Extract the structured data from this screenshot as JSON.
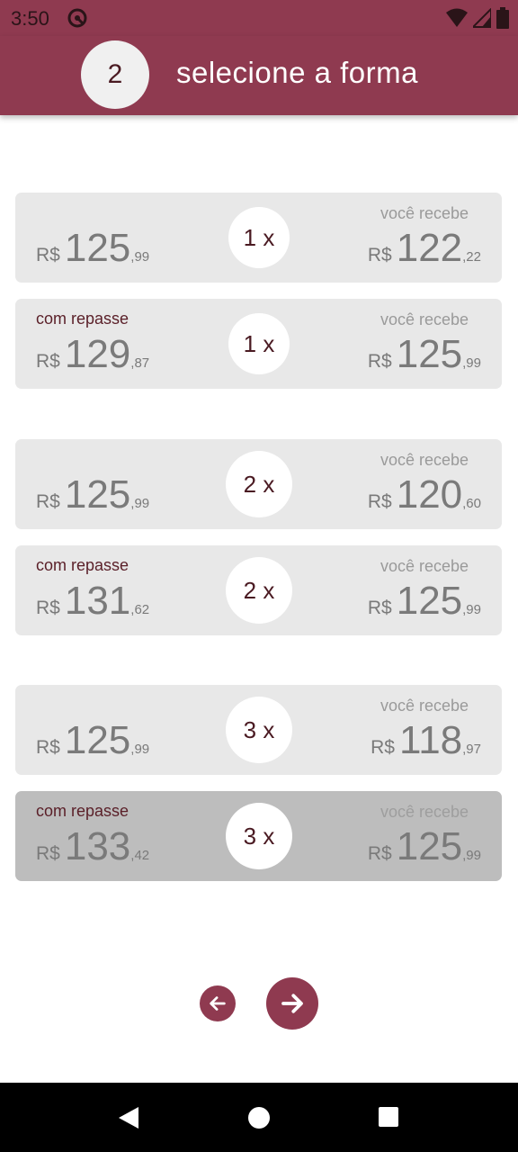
{
  "status_bar": {
    "time": "3:50",
    "icons": [
      "do-not-disturb-icon",
      "wifi-icon",
      "signal-icon",
      "battery-icon"
    ]
  },
  "header": {
    "step": "2",
    "title": "selecione a forma"
  },
  "labels": {
    "currency": "R$",
    "receive": "você recebe",
    "with_fee": "com repasse"
  },
  "options": [
    {
      "installments": "1 x",
      "repasse": "",
      "price_int": "125",
      "price_cents": ",99",
      "receive_int": "122",
      "receive_cents": ",22",
      "selected": false
    },
    {
      "installments": "1 x",
      "repasse": "com repasse",
      "price_int": "129",
      "price_cents": ",87",
      "receive_int": "125",
      "receive_cents": ",99",
      "selected": false
    },
    {
      "installments": "2 x",
      "repasse": "",
      "price_int": "125",
      "price_cents": ",99",
      "receive_int": "120",
      "receive_cents": ",60",
      "selected": false
    },
    {
      "installments": "2 x",
      "repasse": "com repasse",
      "price_int": "131",
      "price_cents": ",62",
      "receive_int": "125",
      "receive_cents": ",99",
      "selected": false
    },
    {
      "installments": "3 x",
      "repasse": "",
      "price_int": "125",
      "price_cents": ",99",
      "receive_int": "118",
      "receive_cents": ",97",
      "selected": false
    },
    {
      "installments": "3 x",
      "repasse": "com repasse",
      "price_int": "133",
      "price_cents": ",42",
      "receive_int": "125",
      "receive_cents": ",99",
      "selected": true
    }
  ],
  "colors": {
    "primary": "#8f3a50",
    "card": "#e8e8e8",
    "card_selected": "#bdbdbd"
  },
  "navigation": {
    "back_icon": "arrow-left-icon",
    "next_icon": "arrow-right-icon"
  },
  "system_nav": [
    "back-triangle-icon",
    "home-circle-icon",
    "recents-square-icon"
  ]
}
